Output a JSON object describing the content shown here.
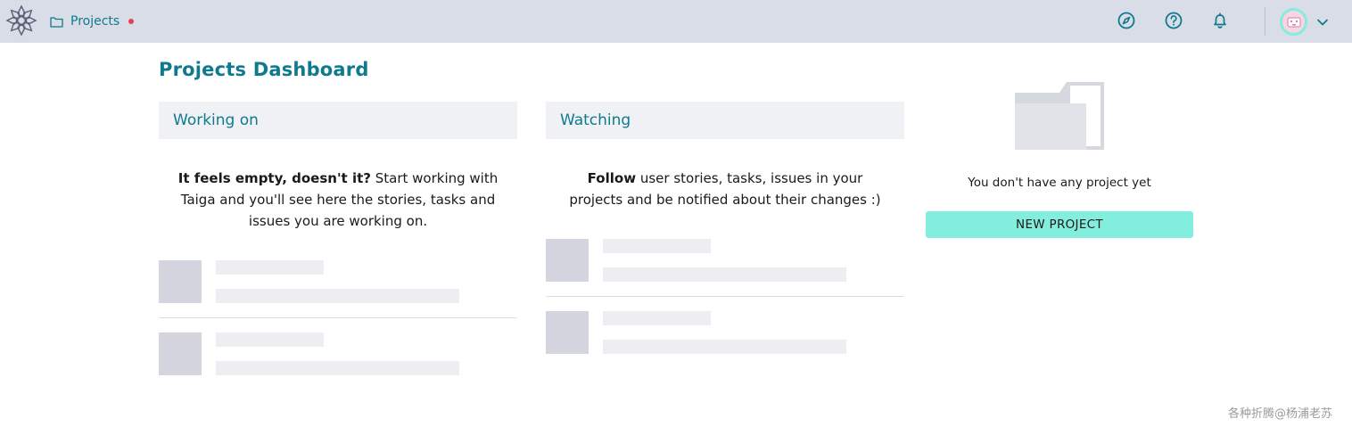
{
  "topbar": {
    "nav_projects_label": "Projects",
    "icons": [
      "logo-icon",
      "folder-icon",
      "discover-icon",
      "help-icon",
      "notifications-icon",
      "chevron-down-icon"
    ],
    "colors": {
      "bar_bg": "#d8dde7",
      "accent": "#0f7a8e",
      "notify_dot": "#e44057",
      "avatar_ring": "#83eede"
    }
  },
  "page": {
    "title": "Projects Dashboard"
  },
  "working_on": {
    "header": "Working on",
    "empty_bold": "It feels empty, doesn't it?",
    "empty_rest": " Start working with Taiga and you'll see here the stories, tasks and issues you are working on."
  },
  "watching": {
    "header": "Watching",
    "empty_bold": "Follow",
    "empty_rest": " user stories, tasks, issues in your projects and be notified about their changes :)"
  },
  "projects_panel": {
    "empty_message": "You don't have any project yet",
    "new_project_label": "NEW PROJECT"
  },
  "watermark": "各种折腾@杨浦老苏"
}
